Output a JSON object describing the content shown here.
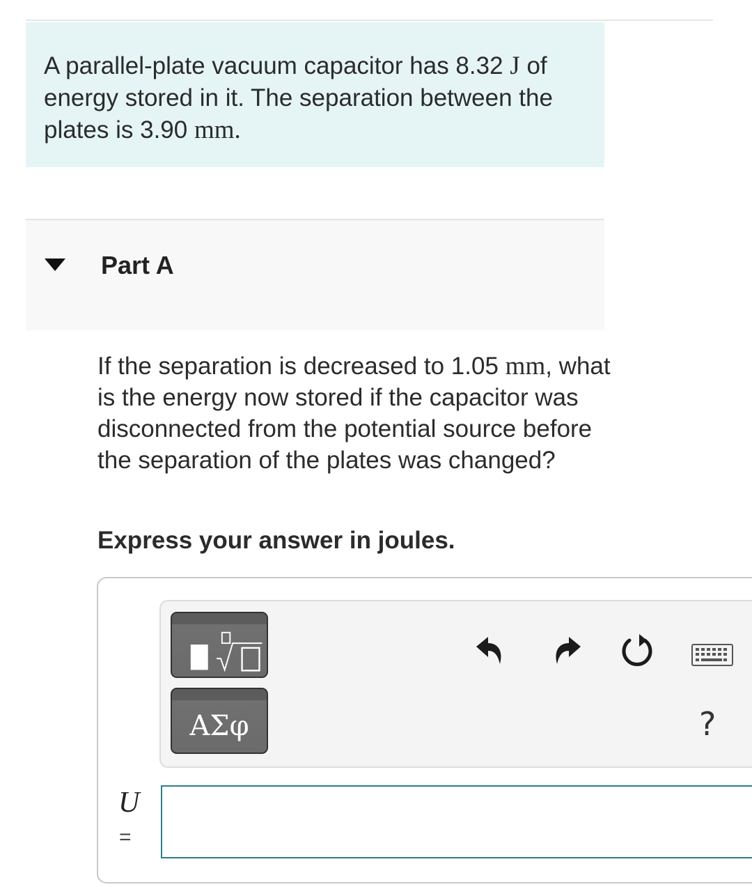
{
  "intro": {
    "part1": "A parallel-plate vacuum capacitor has 8.32",
    "unit1": "J",
    "part2": "of energy stored in it. The separation between the plates is 3.90",
    "unit2": "mm",
    "part3": "."
  },
  "part": {
    "title": "Part A"
  },
  "question": {
    "part1": "If the separation is decreased to 1.05",
    "unit1": "mm",
    "part2": ", what is the energy now stored if the capacitor was disconnected from the potential source before the separation of the plates was changed?"
  },
  "instruction": "Express your answer in joules.",
  "toolbar": {
    "greek_label": "ΑΣφ",
    "help_label": "?"
  },
  "answer": {
    "variable": "U",
    "equals": "=",
    "value": ""
  }
}
